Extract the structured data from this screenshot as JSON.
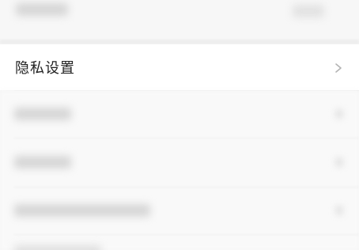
{
  "settings": {
    "privacy_label": "隐私设置"
  },
  "icons": {
    "chevron": "chevron-right-icon"
  }
}
